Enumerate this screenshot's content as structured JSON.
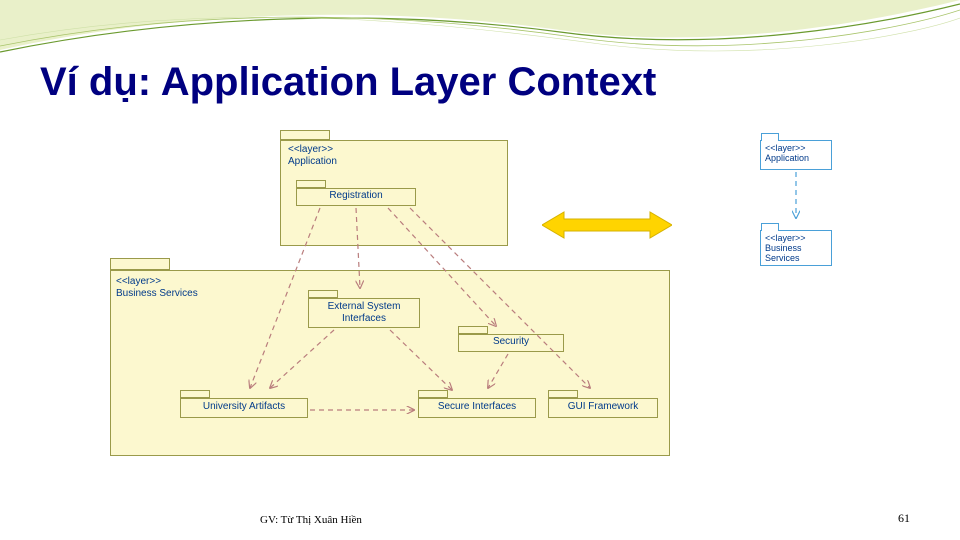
{
  "title": "Ví dụ: Application Layer Context",
  "footer": {
    "author": "GV: Từ Thị Xuân Hiền",
    "page": "61"
  },
  "packages": {
    "application": {
      "stereotype": "<<layer>>",
      "name": "Application"
    },
    "registration": {
      "name": "Registration"
    },
    "business_services": {
      "stereotype": "<<layer>>",
      "name": "Business Services"
    },
    "external_system_interfaces": {
      "name": "External System\nInterfaces"
    },
    "security": {
      "name": "Security"
    },
    "university_artifacts": {
      "name": "University Artifacts"
    },
    "secure_interfaces": {
      "name": "Secure Interfaces"
    },
    "gui_framework": {
      "name": "GUI Framework"
    }
  },
  "mini": {
    "application": {
      "stereotype": "<<layer>>",
      "name": "Application"
    },
    "business_services": {
      "stereotype": "<<layer>>",
      "name": "Business\nServices"
    }
  },
  "colors": {
    "package_fill": "#FCF8CF",
    "package_border": "#9a9a4a",
    "arrow": "#b97d7d",
    "mini_border": "#4aa0d8",
    "highlight": "#ffd400",
    "title": "#000080"
  }
}
